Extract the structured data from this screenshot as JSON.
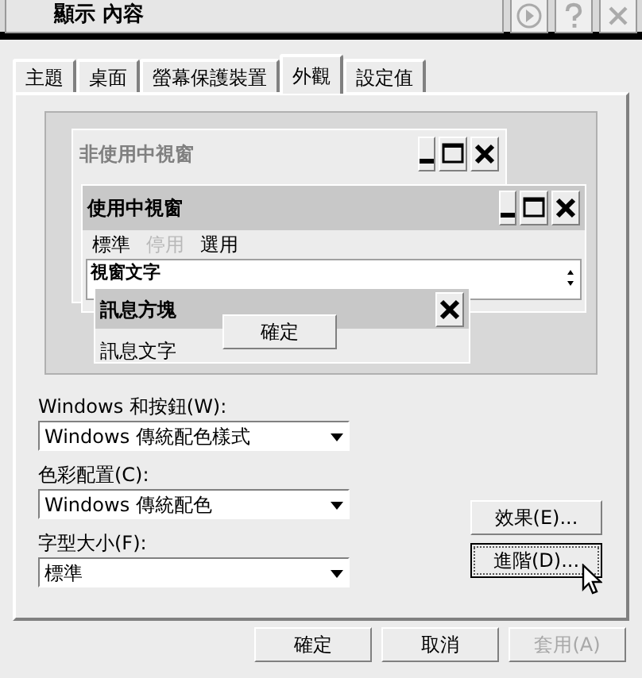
{
  "window": {
    "title": "顯示 內容"
  },
  "tabs": [
    {
      "label": "主題",
      "selected": false
    },
    {
      "label": "桌面",
      "selected": false
    },
    {
      "label": "螢幕保護裝置",
      "selected": false
    },
    {
      "label": "外觀",
      "selected": true
    },
    {
      "label": "設定值",
      "selected": false
    }
  ],
  "preview": {
    "inactive_window": {
      "title": "非使用中視窗"
    },
    "active_window": {
      "title": "使用中視窗",
      "menu": [
        {
          "label": "標準",
          "disabled": false
        },
        {
          "label": "停用",
          "disabled": true
        },
        {
          "label": "選用",
          "disabled": false
        }
      ],
      "window_text": "視窗文字"
    },
    "message_box": {
      "title": "訊息方塊",
      "text": "訊息文字",
      "button": "確定"
    }
  },
  "fields": [
    {
      "label": "Windows 和按鈕(W):",
      "value": "Windows 傳統配色樣式"
    },
    {
      "label": "色彩配置(C):",
      "value": "Windows 傳統配色"
    },
    {
      "label": "字型大小(F):",
      "value": "標準"
    }
  ],
  "side_buttons": [
    {
      "label": "效果(E)...",
      "focused": false
    },
    {
      "label": "進階(D)...",
      "focused": true
    }
  ],
  "dialog_buttons": [
    {
      "label": "確定",
      "disabled": false
    },
    {
      "label": "取消",
      "disabled": false
    },
    {
      "label": "套用(A)",
      "disabled": true
    }
  ]
}
